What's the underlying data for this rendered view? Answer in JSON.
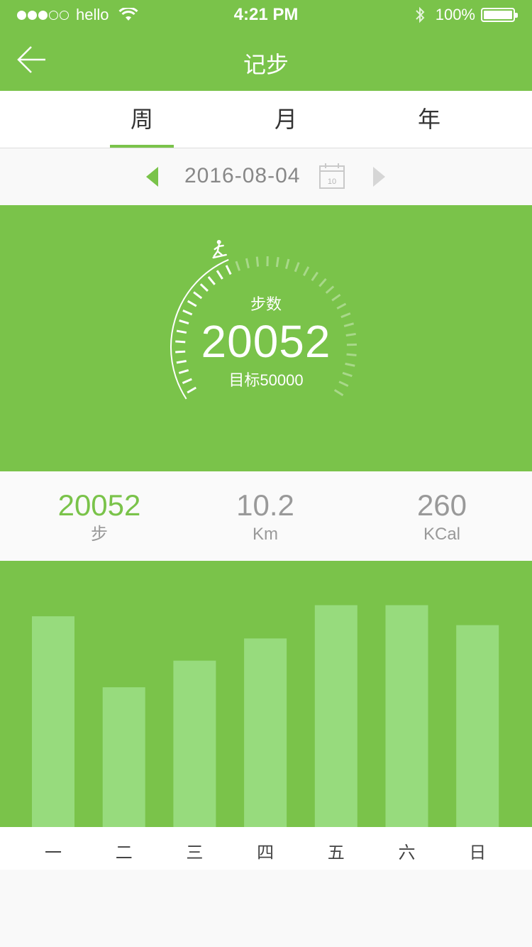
{
  "status_bar": {
    "carrier": "hello",
    "time": "4:21 PM",
    "battery": "100%",
    "signal_full": 3,
    "signal_total": 5
  },
  "nav": {
    "title": "记步"
  },
  "tabs": [
    {
      "label": "周",
      "active": true
    },
    {
      "label": "月",
      "active": false
    },
    {
      "label": "年",
      "active": false
    }
  ],
  "date_picker": {
    "date": "2016-08-04",
    "calendar_day": "10"
  },
  "gauge": {
    "label": "步数",
    "steps": "20052",
    "goal_text": "目标50000",
    "progress_fraction": 0.4,
    "icon": "runner-icon"
  },
  "stats": [
    {
      "value": "20052",
      "unit": "步"
    },
    {
      "value": "10.2",
      "unit": "Km"
    },
    {
      "value": "260",
      "unit": "KCal"
    }
  ],
  "chart_data": {
    "type": "bar",
    "categories": [
      "一",
      "二",
      "三",
      "四",
      "五",
      "六",
      "日"
    ],
    "values": [
      95,
      63,
      75,
      85,
      100,
      100,
      91
    ],
    "ylim": [
      0,
      120
    ]
  },
  "colors": {
    "accent": "#7ac34a",
    "bar": "#97db7d"
  }
}
